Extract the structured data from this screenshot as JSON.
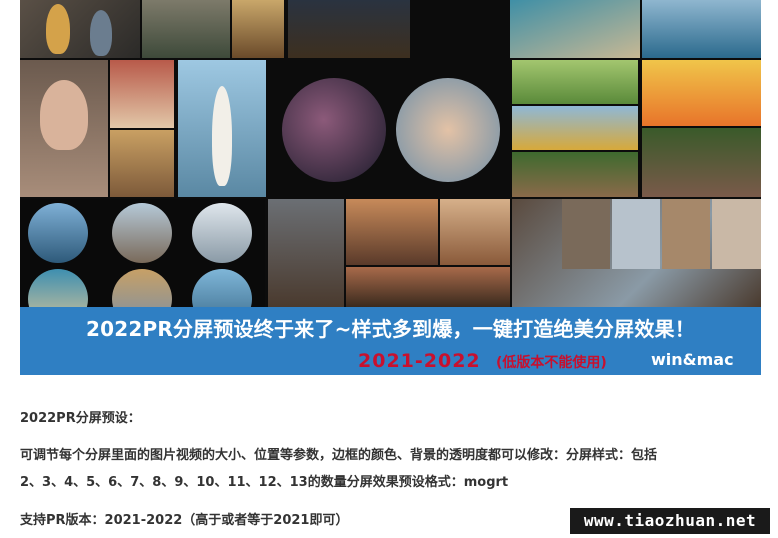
{
  "banner": {
    "title": "2022PR分屏预设终于来了~样式多到爆，一键打造绝美分屏效果！",
    "years": "2021-2022",
    "note": "(低版本不能使用)",
    "platform": "win&mac",
    "ribbon_color": "#2f7fc3",
    "accent_color": "#c8102e"
  },
  "article": {
    "heading": "2022PR分屏预设：",
    "description_line1": "可调节每个分屏里面的图片视频的大小、位置等参数，边框的颜色、背景的透明度都可以修改：分屏样式：包括",
    "description_line2": "2、3、4、5、6、7、8、9、10、11、12、13的数量分屏效果预设格式：mogrt",
    "support": "支持PR版本：2021-2022（高于或者等于2021即可）"
  },
  "watermark": "www.tiaozhuan.net"
}
